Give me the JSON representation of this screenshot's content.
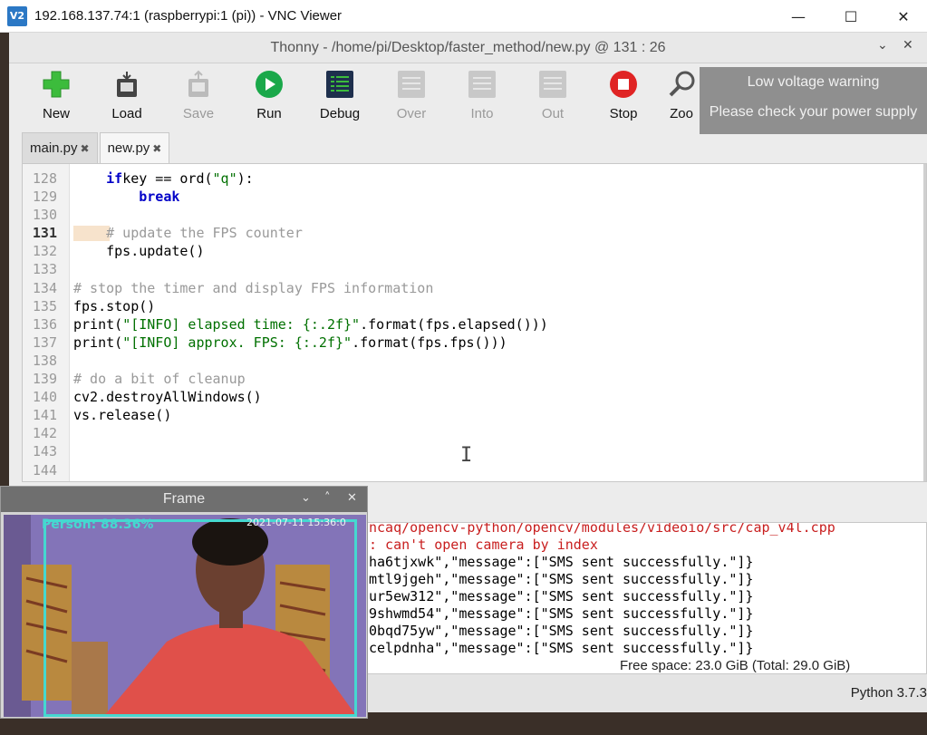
{
  "vnc": {
    "logo": "V2",
    "title": "192.168.137.74:1 (raspberrypi:1 (pi)) - VNC Viewer",
    "minimize": "—",
    "maximize": "☐",
    "close": "✕"
  },
  "thonny": {
    "title": "Thonny  -  /home/pi/Desktop/faster_method/new.py  @  131 : 26",
    "collapse": "⌄",
    "close": "✕"
  },
  "toolbar": {
    "new": "New",
    "load": "Load",
    "save": "Save",
    "run": "Run",
    "debug": "Debug",
    "over": "Over",
    "into": "Into",
    "out": "Out",
    "stop": "Stop",
    "zoom": "Zoo"
  },
  "tabs": [
    {
      "label": "main.py",
      "close": "✖"
    },
    {
      "label": "new.py",
      "close": "✖"
    }
  ],
  "editor": {
    "lines": [
      {
        "n": "128",
        "indent": "    ",
        "parts": [
          [
            "kw",
            "if"
          ],
          [
            "",
            "key == ord("
          ],
          [
            "str",
            "\"q\""
          ],
          [
            "",
            "):"
          ]
        ]
      },
      {
        "n": "129",
        "indent": "        ",
        "parts": [
          [
            "kw",
            "break"
          ]
        ]
      },
      {
        "n": "130",
        "indent": "",
        "parts": []
      },
      {
        "n": "131",
        "indent": "    ",
        "parts": [
          [
            "cm",
            "# update the FPS counter"
          ]
        ],
        "current": true
      },
      {
        "n": "132",
        "indent": "    ",
        "parts": [
          [
            "",
            "fps.update()"
          ]
        ]
      },
      {
        "n": "133",
        "indent": "",
        "parts": []
      },
      {
        "n": "134",
        "indent": "",
        "parts": [
          [
            "cm",
            "# stop the timer and display FPS information"
          ]
        ]
      },
      {
        "n": "135",
        "indent": "",
        "parts": [
          [
            "",
            "fps.stop()"
          ]
        ]
      },
      {
        "n": "136",
        "indent": "",
        "parts": [
          [
            "",
            "print("
          ],
          [
            "str",
            "\"[INFO] elapsed time: {:.2f}\""
          ],
          [
            "",
            ".format(fps.elapsed()))"
          ]
        ]
      },
      {
        "n": "137",
        "indent": "",
        "parts": [
          [
            "",
            "print("
          ],
          [
            "str",
            "\"[INFO] approx. FPS: {:.2f}\""
          ],
          [
            "",
            ".format(fps.fps()))"
          ]
        ]
      },
      {
        "n": "138",
        "indent": "",
        "parts": []
      },
      {
        "n": "139",
        "indent": "",
        "parts": [
          [
            "cm",
            "# do a bit of cleanup"
          ]
        ]
      },
      {
        "n": "140",
        "indent": "",
        "parts": [
          [
            "",
            "cv2.destroyAllWindows()"
          ]
        ]
      },
      {
        "n": "141",
        "indent": "",
        "parts": [
          [
            "",
            "vs.release()"
          ]
        ]
      },
      {
        "n": "142",
        "indent": "",
        "parts": []
      },
      {
        "n": "143",
        "indent": "",
        "parts": []
      },
      {
        "n": "144",
        "indent": "",
        "parts": []
      }
    ]
  },
  "shell": {
    "lines": [
      {
        "text": "ncaq/opencv-python/opencv/modules/videoio/src/cap_v4l.cpp",
        "type": "err"
      },
      {
        "text": ": can't open camera by index",
        "type": "err"
      },
      {
        "text": "ha6tjxwk\",\"message\":[\"SMS sent successfully.\"]}",
        "type": "out"
      },
      {
        "text": "mtl9jgeh\",\"message\":[\"SMS sent successfully.\"]}",
        "type": "out"
      },
      {
        "text": "ur5ew312\",\"message\":[\"SMS sent successfully.\"]}",
        "type": "out"
      },
      {
        "text": "9shwmd54\",\"message\":[\"SMS sent successfully.\"]}",
        "type": "out"
      },
      {
        "text": "0bqd75yw\",\"message\":[\"SMS sent successfully.\"]}",
        "type": "out"
      },
      {
        "text": "celpdnha\",\"message\":[\"SMS sent successfully.\"]}",
        "type": "out"
      }
    ]
  },
  "status": {
    "python": "Python 3.7.3",
    "freespace": "Free space: 23.0 GiB (Total: 29.0 GiB)"
  },
  "notification": {
    "title": "Low voltage warning",
    "body": "Please check your power supply"
  },
  "frame": {
    "title": "Frame",
    "collapse": "⌄",
    "up": "˄",
    "close": "✕",
    "label": "Person: 88.36%",
    "timestamp": "2021-07-11  15:36:0"
  },
  "colors": {
    "detection": "#45d8d0",
    "error": "#c81e1e",
    "string": "#007000",
    "keyword": "#0000c8",
    "comment": "#999999"
  }
}
